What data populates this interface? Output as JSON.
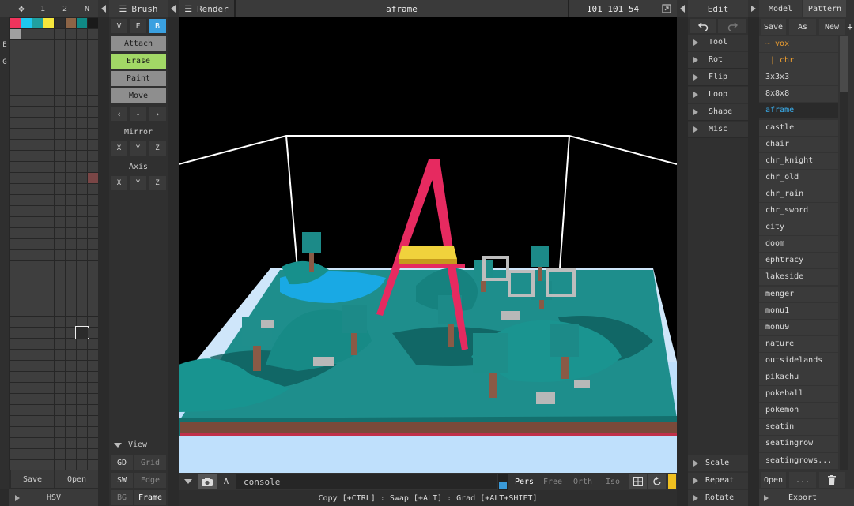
{
  "palette": {
    "tabs": [
      "1",
      "2",
      "N"
    ],
    "swatches": [
      "#f0345c",
      "#1ec8f0",
      "#20a0a0",
      "#f5e63c",
      "#2e2e2e",
      "#8c6446",
      "#108a86"
    ],
    "side_labels": [
      "E",
      "G"
    ],
    "save_label": "Save",
    "open_label": "Open",
    "hsv_label": "HSV"
  },
  "brush": {
    "title": "Brush",
    "modes": [
      "V",
      "F",
      "B"
    ],
    "actions": [
      "Attach",
      "Erase",
      "Paint",
      "Move"
    ],
    "nav": [
      "‹",
      "-",
      "›"
    ],
    "mirror_label": "Mirror",
    "mirror_axes": [
      "X",
      "Y",
      "Z"
    ],
    "axis_label": "Axis",
    "axis_axes": [
      "X",
      "Y",
      "Z"
    ],
    "view_label": "View",
    "view_rows": [
      [
        "GD",
        "Grid"
      ],
      [
        "SW",
        "Edge"
      ],
      [
        "BG",
        "Frame"
      ]
    ]
  },
  "render": {
    "title": "Render",
    "filename": "aframe",
    "dims": "101 101 54"
  },
  "viewport": {
    "console_label": "console",
    "a_label": "A",
    "projections": [
      "Pers",
      "Free",
      "Orth",
      "Iso"
    ],
    "status": "Copy [+CTRL] : Swap [+ALT] : Grad [+ALT+SHIFT]"
  },
  "edit": {
    "title": "Edit",
    "items": [
      "Tool",
      "Rot",
      "Flip",
      "Loop",
      "Shape",
      "Misc"
    ],
    "bottom_items": [
      "Scale",
      "Repeat",
      "Rotate"
    ]
  },
  "model": {
    "tabs": [
      "Model",
      "Pattern"
    ],
    "actions": [
      "Save",
      "As",
      "New"
    ],
    "folders": [
      "~ vox",
      "| chr"
    ],
    "files": [
      "3x3x3",
      "8x8x8",
      "aframe",
      "castle",
      "chair",
      "chr_knight",
      "chr_old",
      "chr_rain",
      "chr_sword",
      "city",
      "doom",
      "ephtracy",
      "lakeside",
      "menger",
      "monu1",
      "monu9",
      "nature",
      "outsidelands",
      "pikachu",
      "pokeball",
      "pokemon",
      "seatin",
      "seatingrow",
      "seatingrows..."
    ],
    "selected": "aframe",
    "open_label": "Open",
    "more_label": "...",
    "export_label": "Export"
  }
}
